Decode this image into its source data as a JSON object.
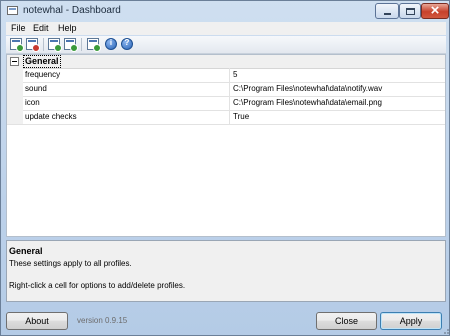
{
  "window": {
    "title": "notewhal - Dashboard"
  },
  "menu": {
    "items": [
      "File",
      "Edit",
      "Help"
    ]
  },
  "toolbar": {
    "buttons": [
      {
        "icon": "new-profile-icon",
        "color": "#3a9a3a"
      },
      {
        "icon": "delete-profile-icon",
        "color": "#c8392e"
      },
      {
        "icon": "profile-settings-icon",
        "color": "#3a9a3a"
      },
      {
        "icon": "profile-refresh-icon",
        "color": "#3a9a3a"
      },
      {
        "icon": "check-now-icon",
        "color": "#3a9a3a"
      },
      {
        "icon": "info-icon",
        "color": "#2a64b6"
      },
      {
        "icon": "help-icon",
        "color": "#2a64b6"
      }
    ]
  },
  "grid": {
    "category": "General",
    "rows": [
      {
        "name": "frequency",
        "value": "5"
      },
      {
        "name": "sound",
        "value": "C:\\Program Files\\notewhal\\data\\notify.wav"
      },
      {
        "name": "icon",
        "value": "C:\\Program Files\\notewhal\\data\\email.png"
      },
      {
        "name": "update checks",
        "value": "True"
      }
    ]
  },
  "description": {
    "title": "General",
    "line1": "These settings apply to all profiles.",
    "line2": "Right-click a cell for options to add/delete profiles."
  },
  "footer": {
    "about_label": "About",
    "version": "version 0.9.15",
    "close_label": "Close",
    "apply_label": "Apply"
  },
  "colors": {
    "titlebar": "#bcd1ea",
    "close_button": "#c7412c",
    "default_button_border": "#3c7fb1"
  }
}
